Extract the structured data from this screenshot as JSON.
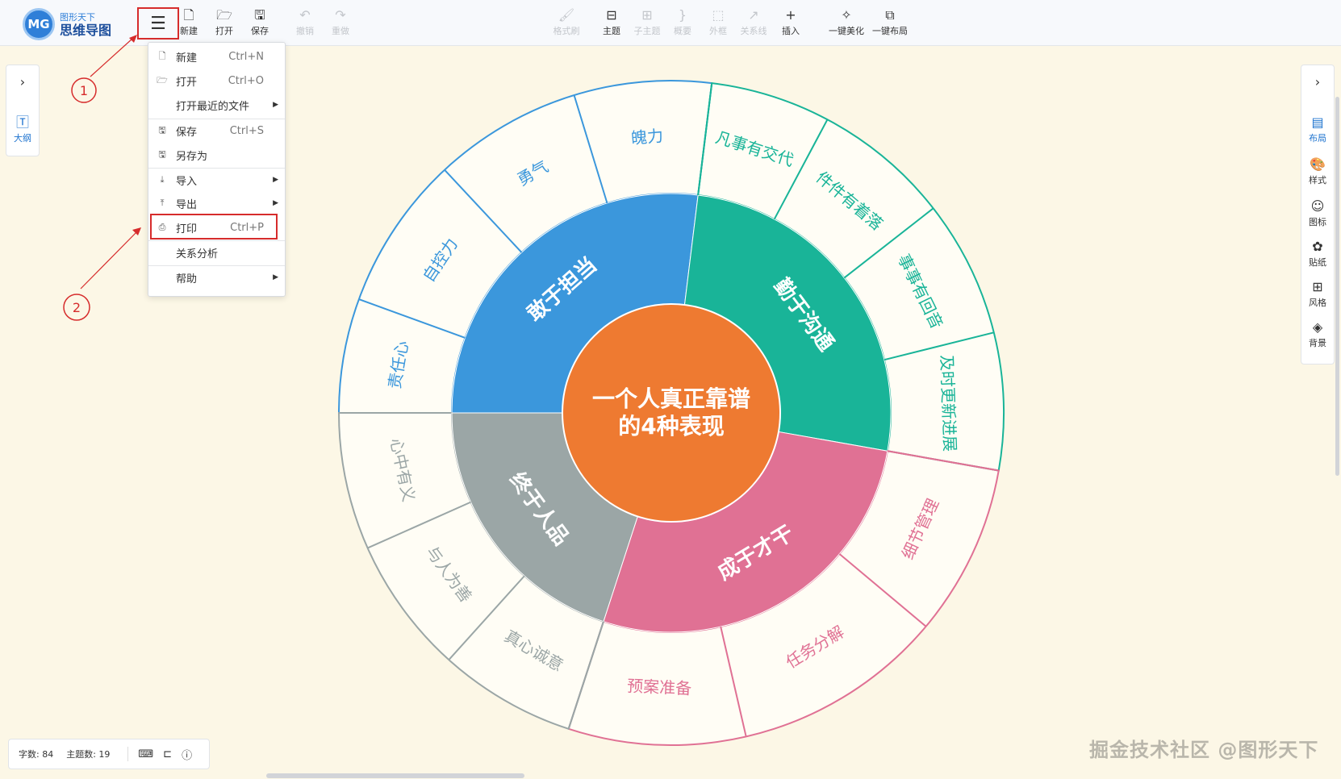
{
  "logo": {
    "mark": "MG",
    "subtitle": "图形天下",
    "title": "思维导图"
  },
  "toolbar": {
    "menu_icon": "hamburger-icon",
    "file_buttons": [
      {
        "label": "新建",
        "icon": "new-file-icon"
      },
      {
        "label": "打开",
        "icon": "folder-open-icon"
      },
      {
        "label": "保存",
        "icon": "save-icon"
      }
    ],
    "undo_buttons": [
      {
        "label": "撤销",
        "icon": "undo-icon"
      },
      {
        "label": "重做",
        "icon": "redo-icon"
      }
    ],
    "edit_buttons": [
      {
        "label": "格式刷",
        "icon": "format-brush-icon",
        "disabled": true
      },
      {
        "label": "主题",
        "icon": "topic-icon",
        "disabled": false
      },
      {
        "label": "子主题",
        "icon": "subtopic-icon",
        "disabled": true
      },
      {
        "label": "概要",
        "icon": "summary-icon",
        "disabled": true
      },
      {
        "label": "外框",
        "icon": "boundary-icon",
        "disabled": true
      },
      {
        "label": "关系线",
        "icon": "relation-line-icon",
        "disabled": true
      },
      {
        "label": "插入",
        "icon": "plus-icon",
        "disabled": false
      }
    ],
    "beautify": {
      "label": "一键美化",
      "icon": "magic-wand-icon"
    },
    "layout": {
      "label": "一键布局",
      "icon": "layout-tree-icon"
    }
  },
  "menu": {
    "items": [
      {
        "icon": "new-file-icon",
        "label": "新建",
        "shortcut": "Ctrl+N",
        "submenu": false
      },
      {
        "icon": "folder-open-icon",
        "label": "打开",
        "shortcut": "Ctrl+O",
        "submenu": false
      },
      {
        "icon": "",
        "label": "打开最近的文件",
        "shortcut": "",
        "submenu": true
      },
      {
        "icon": "save-icon",
        "label": "保存",
        "shortcut": "Ctrl+S",
        "submenu": false
      },
      {
        "icon": "save-as-icon",
        "label": "另存为",
        "shortcut": "",
        "submenu": false
      },
      {
        "icon": "import-icon",
        "label": "导入",
        "shortcut": "",
        "submenu": true
      },
      {
        "icon": "export-icon",
        "label": "导出",
        "shortcut": "",
        "submenu": true
      },
      {
        "icon": "print-icon",
        "label": "打印",
        "shortcut": "Ctrl+P",
        "submenu": false
      },
      {
        "icon": "",
        "label": "关系分析",
        "shortcut": "",
        "submenu": false
      },
      {
        "icon": "",
        "label": "帮助",
        "shortcut": "",
        "submenu": true
      }
    ]
  },
  "annotations": {
    "step1": "1",
    "step2": "2",
    "color": "#d62c2c"
  },
  "left_panel": {
    "outline_label": "大纲",
    "expand_icon": "chevron-right-icon",
    "outline_icon": "outline-icon"
  },
  "right_panel": {
    "expand_icon": "chevron-right-icon",
    "items": [
      {
        "label": "布局",
        "icon": "layout-icon",
        "selected": true
      },
      {
        "label": "样式",
        "icon": "palette-icon",
        "selected": false
      },
      {
        "label": "图标",
        "icon": "smiley-icon",
        "selected": false
      },
      {
        "label": "贴纸",
        "icon": "sticker-icon",
        "selected": false
      },
      {
        "label": "风格",
        "icon": "style-grid-icon",
        "selected": false
      },
      {
        "label": "背景",
        "icon": "layers-icon",
        "selected": false
      }
    ]
  },
  "status": {
    "word_count": "字数: 84",
    "topic_count": "主题数: 19"
  },
  "watermark": "掘金技术社区 @图形天下",
  "mindmap": {
    "center": "一个人真正靠谱\n的4种表现",
    "center_color": "#ee7a31",
    "branches": [
      {
        "label": "敢于担当",
        "color": "#3b97dc",
        "children": [
          "责任心",
          "自控力",
          "勇气",
          "魄力"
        ]
      },
      {
        "label": "勤于沟通",
        "color": "#19b498",
        "children": [
          "凡事有交代",
          "件件有着落",
          "事事有回音",
          "及时更新进展"
        ]
      },
      {
        "label": "成于才干",
        "color": "#e07194",
        "children": [
          "细节管理",
          "任务分解",
          "预案准备"
        ]
      },
      {
        "label": "终于人品",
        "color": "#9ba6a6",
        "children": [
          "真心诚意",
          "与人为善",
          "心中有义"
        ]
      }
    ]
  }
}
